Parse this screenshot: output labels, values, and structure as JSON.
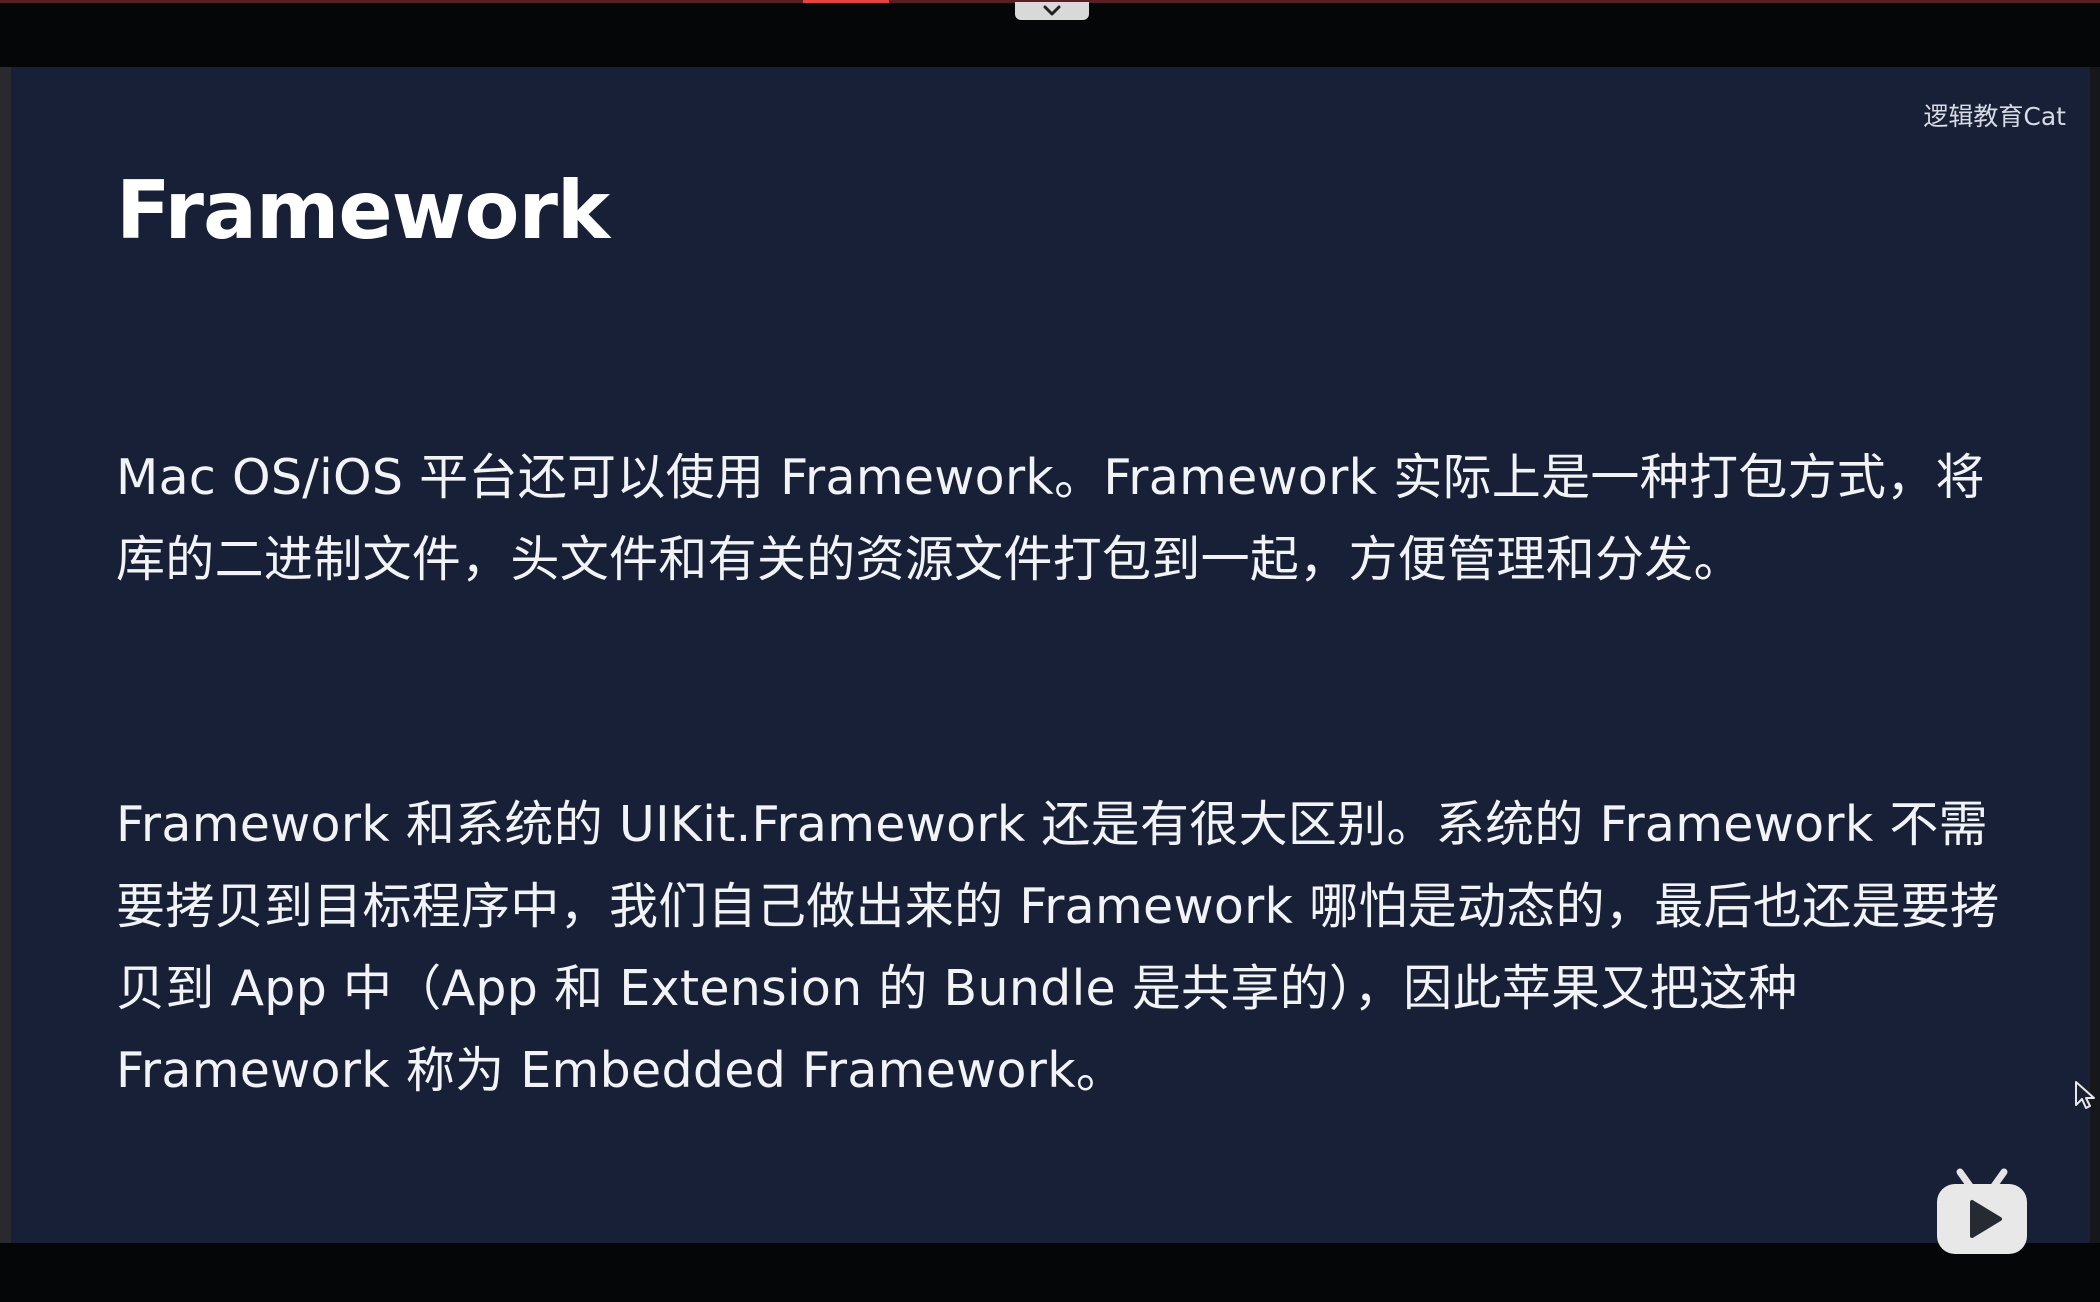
{
  "watermark": "逻辑教育Cat",
  "slide": {
    "title": "Framework",
    "paragraphs": [
      "Mac OS/iOS 平台还可以使用 Framework。Framework 实际上是一种打包方式，将库的二进制文件，头文件和有关的资源文件打包到一起，方便管理和分发。",
      "Framework 和系统的 UIKit.Framework 还是有很大区别。系统的 Framework 不需要拷贝到目标程序中，我们自己做出来的 Framework 哪怕是动态的，最后也还是要拷贝到 App 中（App 和 Extension 的 Bundle 是共享的），因此苹果又把这种 Framework 称为 Embedded Framework。"
    ]
  },
  "icons": {
    "collapse": "chevron-down-icon",
    "cursor": "mouse-pointer-icon",
    "player": "bilibili-play-icon"
  },
  "colors": {
    "slide_background": "#172036",
    "text": "#f2f3f5",
    "accent": "#e0463f"
  }
}
